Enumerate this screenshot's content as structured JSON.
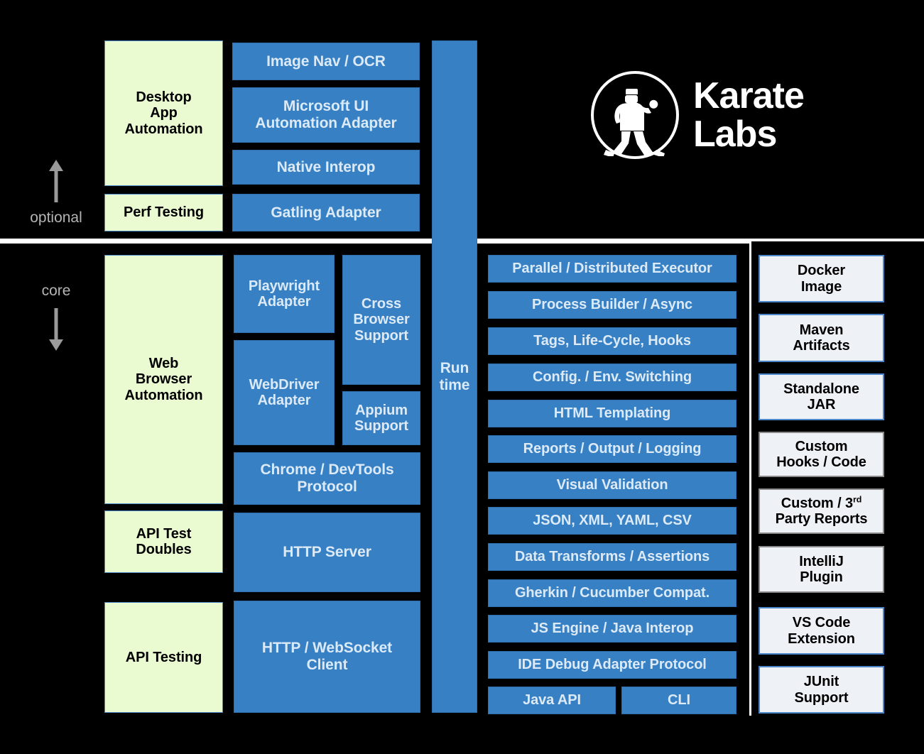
{
  "brand": {
    "name_line1": "Karate",
    "name_line2": "Labs",
    "mark_icon": "karate-figure-icon"
  },
  "sections": {
    "optional_label": "optional",
    "core_label": "core"
  },
  "runtime": {
    "line1": "Run",
    "line2": "time"
  },
  "optional": {
    "capabilities": [
      {
        "label": "Desktop\nApp\nAutomation"
      },
      {
        "label": "Perf Testing"
      }
    ],
    "modules": [
      {
        "label": "Image Nav /  OCR"
      },
      {
        "label": "Microsoft UI\nAutomation Adapter"
      },
      {
        "label": "Native Interop"
      },
      {
        "label": "Gatling Adapter"
      }
    ]
  },
  "core": {
    "capabilities": [
      {
        "label": "Web\nBrowser\nAutomation"
      },
      {
        "label": "API Test\nDoubles"
      },
      {
        "label": "API Testing"
      }
    ],
    "modules": [
      {
        "label": "Playwright\nAdapter"
      },
      {
        "label": "WebDriver\nAdapter"
      },
      {
        "label": "Cross\nBrowser\nSupport"
      },
      {
        "label": "Appium\nSupport"
      },
      {
        "label": "Chrome / DevTools\nProtocol"
      },
      {
        "label": "HTTP Server"
      },
      {
        "label": "HTTP / WebSocket\nClient"
      }
    ]
  },
  "engine_features": [
    {
      "label": "Parallel / Distributed Executor"
    },
    {
      "label": "Process Builder / Async"
    },
    {
      "label": "Tags, Life-Cycle, Hooks"
    },
    {
      "label": "Config. / Env. Switching"
    },
    {
      "label": "HTML Templating"
    },
    {
      "label": "Reports / Output / Logging"
    },
    {
      "label": "Visual Validation"
    },
    {
      "label": "JSON, XML, YAML, CSV"
    },
    {
      "label": "Data Transforms / Assertions"
    },
    {
      "label": "Gherkin / Cucumber Compat."
    },
    {
      "label": "JS Engine / Java Interop"
    },
    {
      "label": "IDE Debug Adapter Protocol"
    },
    {
      "label": "Java API"
    },
    {
      "label": "CLI"
    }
  ],
  "deliverables": [
    {
      "label": "Docker\nImage",
      "border": "blue"
    },
    {
      "label": "Maven\nArtifacts",
      "border": "blue"
    },
    {
      "label": "Standalone\nJAR",
      "border": "blue"
    },
    {
      "label": "Custom\nHooks / Code",
      "border": "gray"
    },
    {
      "label": "Custom / 3rd\nParty Reports",
      "border": "gray",
      "superscript": "rd"
    },
    {
      "label": "IntelliJ\nPlugin",
      "border": "gray"
    },
    {
      "label": "VS Code\nExtension",
      "border": "blue"
    },
    {
      "label": "JUnit\nSupport",
      "border": "blue"
    }
  ],
  "colors": {
    "background": "#000000",
    "module_blue": "#3780c4",
    "capability_green": "#eafad1",
    "deliverable_gray": "#eef1f6",
    "border_blue": "#4a86c8",
    "border_gray": "#8a8a8a",
    "separator": "#ffffff",
    "label_gray": "#b4b4b4",
    "module_text": "#dceaf7"
  }
}
